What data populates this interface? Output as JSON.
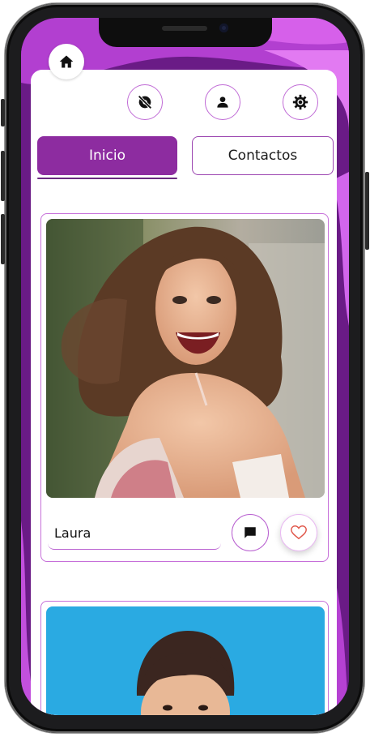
{
  "nav": {
    "home_icon": "home-icon",
    "top_icons": [
      "visibility-off-icon",
      "person-icon",
      "settings-icon"
    ]
  },
  "tabs": [
    {
      "label": "Inicio",
      "active": true
    },
    {
      "label": "Contactos",
      "active": false
    }
  ],
  "cards": [
    {
      "name": "Laura",
      "photo": "woman-laughing-photo",
      "actions": [
        "message-icon",
        "heart-icon"
      ]
    },
    {
      "name": "",
      "photo": "man-blue-background-photo"
    }
  ],
  "colors": {
    "accent": "#8d2ca0",
    "border": "#c66ed9",
    "like": "#e0574a"
  }
}
